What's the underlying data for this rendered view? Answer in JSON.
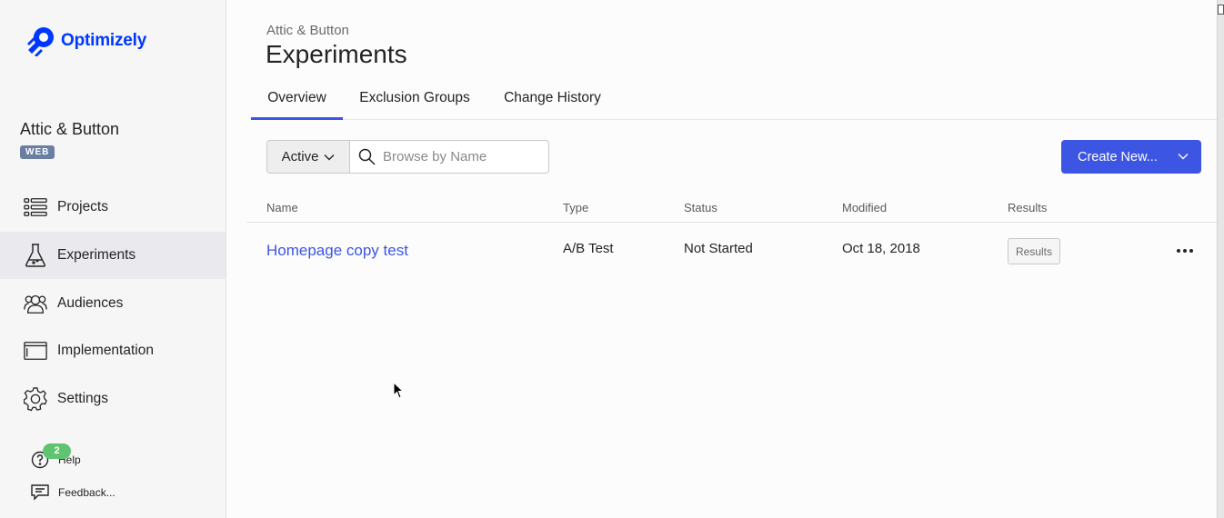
{
  "brand": {
    "name": "Optimizely",
    "color": "#0037ff"
  },
  "sidebar": {
    "project_name": "Attic & Button",
    "badge": "WEB",
    "items": [
      {
        "label": "Projects",
        "icon": "projects-icon"
      },
      {
        "label": "Experiments",
        "icon": "flask-icon",
        "active": true
      },
      {
        "label": "Audiences",
        "icon": "audiences-icon"
      },
      {
        "label": "Implementation",
        "icon": "implementation-icon"
      },
      {
        "label": "Settings",
        "icon": "gear-icon"
      }
    ],
    "help": {
      "label": "Help",
      "badge": "2"
    },
    "feedback": {
      "label": "Feedback..."
    }
  },
  "header": {
    "breadcrumb": "Attic & Button",
    "title": "Experiments"
  },
  "tabs": [
    {
      "label": "Overview",
      "active": true
    },
    {
      "label": "Exclusion Groups"
    },
    {
      "label": "Change History"
    }
  ],
  "toolbar": {
    "filter_label": "Active",
    "search_placeholder": "Browse by Name",
    "create_label": "Create New..."
  },
  "table": {
    "columns": [
      "Name",
      "Type",
      "Status",
      "Modified",
      "Results"
    ],
    "rows": [
      {
        "name": "Homepage copy test",
        "type": "A/B Test",
        "status": "Not Started",
        "modified": "Oct 18, 2018",
        "results_label": "Results"
      }
    ]
  },
  "colors": {
    "accent": "#3d55e3",
    "badge_green": "#5ec46f",
    "web_badge": "#6b7fa3"
  }
}
